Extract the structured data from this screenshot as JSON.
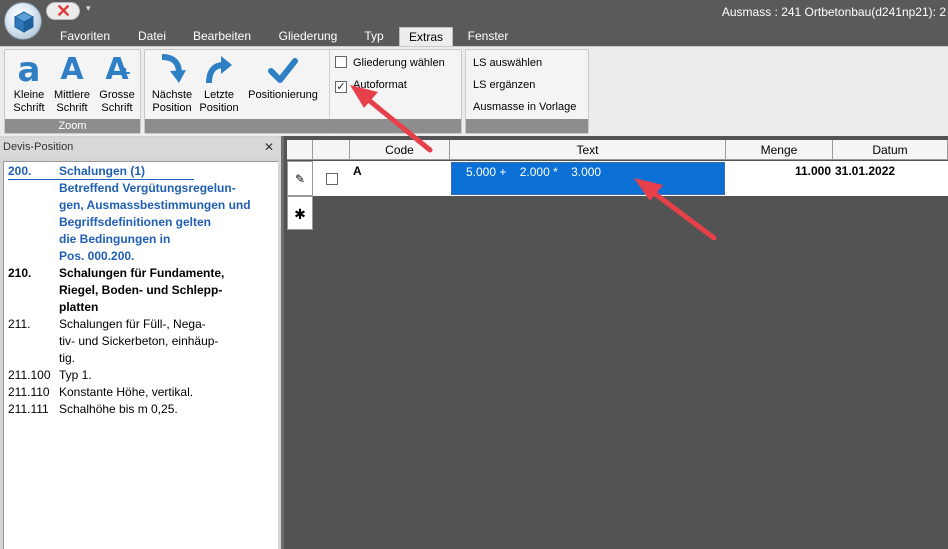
{
  "window": {
    "title": "Ausmass : 241 Ortbetonbau(d241np21): 2",
    "close_glyph": "✕",
    "qa_more": "▾"
  },
  "tabs": [
    "Favoriten",
    "Datei",
    "Bearbeiten",
    "Gliederung",
    "Typ",
    "Extras",
    "Fenster"
  ],
  "active_tab": "Extras",
  "ribbon": {
    "zoom_group": {
      "label": "Zoom",
      "small_font": {
        "glyph": "a",
        "line1": "Kleine",
        "line2": "Schrift"
      },
      "medium_font": {
        "glyph": "A",
        "line1": "Mittlere",
        "line2": "Schrift"
      },
      "large_font": {
        "glyph": "A",
        "line1": "Grosse",
        "line2": "Schrift"
      }
    },
    "nav_group": {
      "next": {
        "line1": "Nächste",
        "line2": "Position"
      },
      "last": {
        "line1": "Letzte",
        "line2": "Position"
      },
      "positioning": {
        "line1": "Positionierung"
      }
    },
    "checkboxes": [
      {
        "label": "Gliederung wählen",
        "checked": false
      },
      {
        "label": "Autoformat",
        "checked": true,
        "mark": "✓"
      }
    ],
    "ls_items": [
      "LS auswählen",
      "LS ergänzen",
      "Ausmasse in Vorlage"
    ]
  },
  "dock": {
    "title": "Devis-Position",
    "close_glyph": "✕",
    "lines": [
      {
        "num": "200.",
        "text": "Schalungen (1)",
        "style": "blue"
      },
      {
        "num": "",
        "text": "Betreffend Vergütungsregelun-",
        "style": "blue"
      },
      {
        "num": "",
        "text": "gen, Ausmassbestimmungen und",
        "style": "blue"
      },
      {
        "num": "",
        "text": "Begriffsdefinitionen gelten",
        "style": "blue"
      },
      {
        "num": "",
        "text": "die Bedingungen in",
        "style": "blue"
      },
      {
        "num": "",
        "text": "Pos. 000.200.",
        "style": "blue"
      },
      {
        "num": "210.",
        "text": "Schalungen für Fundamente,",
        "style": "bold"
      },
      {
        "num": "",
        "text": "Riegel, Boden- und Schlepp-",
        "style": "bold"
      },
      {
        "num": "",
        "text": "platten",
        "style": "bold"
      },
      {
        "num": "211.",
        "text": "Schalungen für Füll-, Nega-",
        "style": "normal"
      },
      {
        "num": "",
        "text": "tiv- und Sickerbeton, einhäup-",
        "style": "normal"
      },
      {
        "num": "",
        "text": "tig.",
        "style": "normal"
      },
      {
        "num": "211.100",
        "text": "Typ 1.",
        "style": "normal"
      },
      {
        "num": "211.110",
        "text": "Konstante Höhe, vertikal.",
        "style": "normal"
      },
      {
        "num": "211.111",
        "text": "Schalhöhe bis m 0,25.",
        "style": "normal"
      }
    ]
  },
  "grid": {
    "columns": [
      "Code",
      "Text",
      "Menge",
      "Datum"
    ],
    "edit_glyph": "✎",
    "new_row_glyph": "✱",
    "row": {
      "code": "A",
      "text": "5.000 +    2.000 *    3.000",
      "menge": "11.000",
      "datum": "31.01.2022"
    }
  },
  "colors": {
    "accent_blue": "#1f5fb5",
    "selection": "#0a70d6",
    "annotation_arrow": "#e8404a"
  }
}
